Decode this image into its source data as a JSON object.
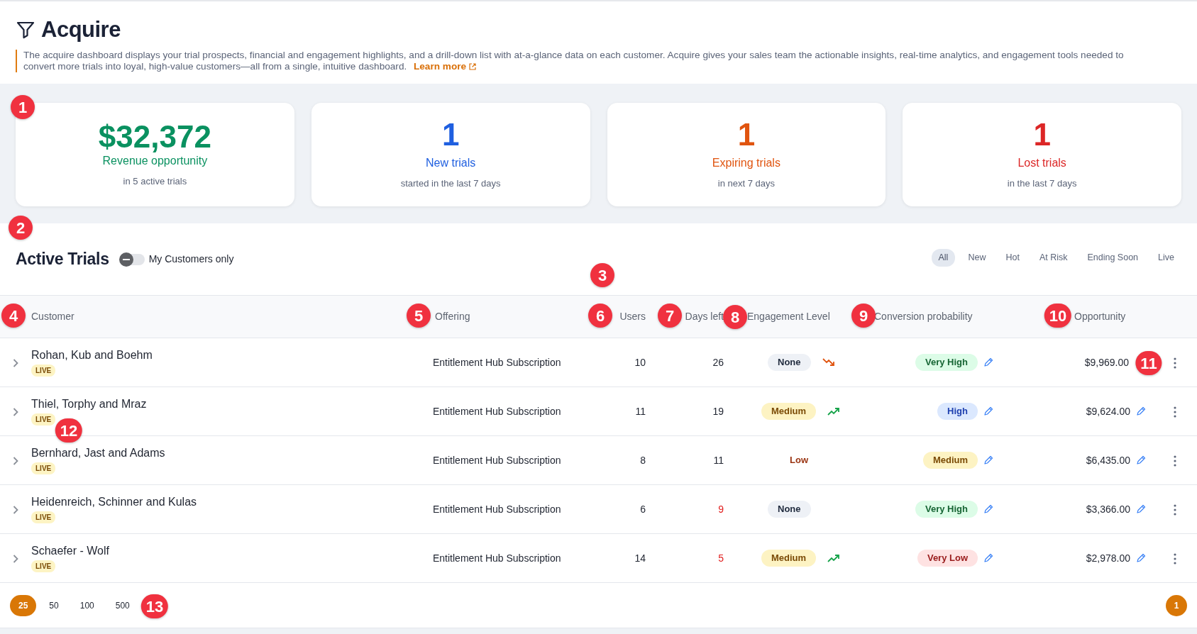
{
  "header": {
    "title": "Acquire",
    "description": "The acquire dashboard displays your trial prospects, financial and engagement highlights, and a drill-down list with at-a-glance data on each customer. Acquire gives your sales team the actionable insights, real-time analytics, and engagement tools needed to convert more trials into loyal, high-value customers—all from a single, intuitive dashboard.",
    "link": "Learn more"
  },
  "stats": [
    {
      "value": "$32,372",
      "label": "Revenue opportunity",
      "sub": "in 5 active trials",
      "color": "#0a9160"
    },
    {
      "value": "1",
      "label": "New trials",
      "sub": "started in the last 7 days",
      "color": "#1f5fe0"
    },
    {
      "value": "1",
      "label": "Expiring trials",
      "sub": "in next 7 days",
      "color": "#e0540f"
    },
    {
      "value": "1",
      "label": "Lost trials",
      "sub": "in the last 7 days",
      "color": "#dc2626"
    }
  ],
  "active_trials": {
    "title": "Active Trials",
    "toggle": {
      "label": "My Customers only",
      "checked": false
    },
    "filters": [
      {
        "label": "All",
        "selected": true
      },
      {
        "label": "New",
        "selected": false
      },
      {
        "label": "Hot",
        "selected": false
      },
      {
        "label": "At Risk",
        "selected": false
      },
      {
        "label": "Ending Soon",
        "selected": false
      },
      {
        "label": "Live",
        "selected": false
      }
    ]
  },
  "table": {
    "columns": [
      "Customer",
      "Offering",
      "Users",
      "Days left",
      "Engagement Level",
      "Conversion probability",
      "Opportunity"
    ],
    "rows": [
      {
        "customer": "Rohan, Kub and Boehm",
        "badge": "LIVE",
        "offering": "Entitlement Hub Subscription",
        "users": "10",
        "days_left": "26",
        "days_warning": false,
        "engagement": {
          "label": "None",
          "kind": "none",
          "trend": {
            "kind": "down"
          }
        },
        "conversion": {
          "label": "Very High",
          "kind": "very-high"
        },
        "opportunity": "$9,969.00"
      },
      {
        "customer": "Thiel, Torphy and Mraz",
        "badge": "LIVE",
        "offering": "Entitlement Hub Subscription",
        "users": "11",
        "days_left": "19",
        "days_warning": false,
        "engagement": {
          "label": "Medium",
          "kind": "medium",
          "trend": {
            "kind": "up"
          }
        },
        "conversion": {
          "label": "High",
          "kind": "high"
        },
        "opportunity": "$9,624.00"
      },
      {
        "customer": "Bernhard, Jast and Adams",
        "badge": "LIVE",
        "offering": "Entitlement Hub Subscription",
        "users": "8",
        "days_left": "11",
        "days_warning": false,
        "engagement": {
          "label": "Low",
          "kind": "low"
        },
        "conversion": {
          "label": "Medium",
          "kind": "medium"
        },
        "opportunity": "$6,435.00"
      },
      {
        "customer": "Heidenreich, Schinner and Kulas",
        "badge": "LIVE",
        "offering": "Entitlement Hub Subscription",
        "users": "6",
        "days_left": "9",
        "days_warning": true,
        "engagement": {
          "label": "None",
          "kind": "none"
        },
        "conversion": {
          "label": "Very High",
          "kind": "very-high"
        },
        "opportunity": "$3,366.00"
      },
      {
        "customer": "Schaefer - Wolf",
        "badge": "LIVE",
        "offering": "Entitlement Hub Subscription",
        "users": "14",
        "days_left": "5",
        "days_warning": true,
        "engagement": {
          "label": "Medium",
          "kind": "medium",
          "trend": {
            "kind": "up"
          }
        },
        "conversion": {
          "label": "Very Low",
          "kind": "very-low"
        },
        "opportunity": "$2,978.00"
      }
    ]
  },
  "page_sizes": [
    {
      "label": "25",
      "selected": true
    },
    {
      "label": "50",
      "selected": false
    },
    {
      "label": "100",
      "selected": false
    },
    {
      "label": "500",
      "selected": false
    }
  ],
  "pagination": [
    {
      "label": "1",
      "selected": true
    }
  ],
  "callouts": [
    "1",
    "2",
    "3",
    "4",
    "5",
    "6",
    "7",
    "8",
    "9",
    "10",
    "11",
    "12",
    "13"
  ]
}
